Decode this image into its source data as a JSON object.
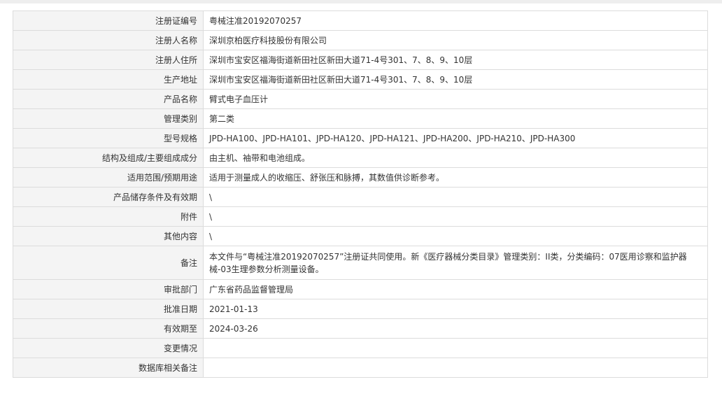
{
  "rows": [
    {
      "label": "注册证编号",
      "value": "粤械注准20192070257"
    },
    {
      "label": "注册人名称",
      "value": "深圳京柏医疗科技股份有限公司"
    },
    {
      "label": "注册人住所",
      "value": "深圳市宝安区福海街道新田社区新田大道71-4号301、7、8、9、10层"
    },
    {
      "label": "生产地址",
      "value": "深圳市宝安区福海街道新田社区新田大道71-4号301、7、8、9、10层"
    },
    {
      "label": "产品名称",
      "value": "臂式电子血压计"
    },
    {
      "label": "管理类别",
      "value": "第二类"
    },
    {
      "label": "型号规格",
      "value": "JPD-HA100、JPD-HA101、JPD-HA120、JPD-HA121、JPD-HA200、JPD-HA210、JPD-HA300"
    },
    {
      "label": "结构及组成/主要组成成分",
      "value": "由主机、袖带和电池组成。"
    },
    {
      "label": "适用范围/预期用途",
      "value": "适用于测量成人的收缩压、舒张压和脉搏，其数值供诊断参考。"
    },
    {
      "label": "产品储存条件及有效期",
      "value": "\\"
    },
    {
      "label": "附件",
      "value": "\\"
    },
    {
      "label": "其他内容",
      "value": "\\"
    },
    {
      "label": "备注",
      "value": "本文件与“粤械注准20192070257”注册证共同使用。新《医疗器械分类目录》管理类别：II类，分类编码：07医用诊察和监护器械-03生理参数分析测量设备。"
    },
    {
      "label": "审批部门",
      "value": "广东省药品监督管理局"
    },
    {
      "label": "批准日期",
      "value": "2021-01-13"
    },
    {
      "label": "有效期至",
      "value": "2024-03-26"
    },
    {
      "label": "变更情况",
      "value": ""
    },
    {
      "label": "数据库相关备注",
      "value": ""
    }
  ]
}
